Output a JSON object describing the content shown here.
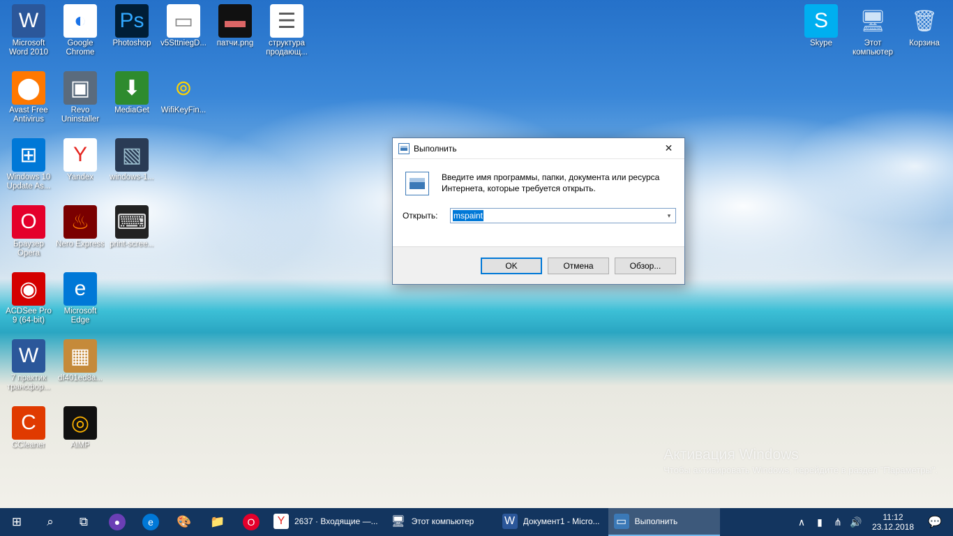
{
  "desktop": {
    "left_columns": [
      [
        {
          "name": "word",
          "label": "Microsoft Word 2010",
          "glyph": "W",
          "bg": "#2b579a",
          "fg": "#fff"
        },
        {
          "name": "avast",
          "label": "Avast Free Antivirus",
          "glyph": "⬤",
          "bg": "#ff7800",
          "fg": "#fff"
        },
        {
          "name": "win10update",
          "label": "Windows 10 Update As...",
          "glyph": "⊞",
          "bg": "#0078d7",
          "fg": "#fff"
        },
        {
          "name": "opera",
          "label": "Браузер Opera",
          "glyph": "O",
          "bg": "#e4002b",
          "fg": "#fff"
        },
        {
          "name": "acdsee",
          "label": "ACDSee Pro 9 (64-bit)",
          "glyph": "◉",
          "bg": "#d40000",
          "fg": "#fff"
        },
        {
          "name": "doc7praktik",
          "label": "7 практик трансфор...",
          "glyph": "W",
          "bg": "#2b579a",
          "fg": "#fff"
        },
        {
          "name": "ccleaner",
          "label": "CCleaner",
          "glyph": "C",
          "bg": "#e03a00",
          "fg": "#fff"
        }
      ],
      [
        {
          "name": "chrome",
          "label": "Google Chrome",
          "glyph": "◐",
          "bg": "#fff",
          "fg": "#1a73e8"
        },
        {
          "name": "revo",
          "label": "Revo Uninstaller",
          "glyph": "▣",
          "bg": "#5a6b7d",
          "fg": "#fff"
        },
        {
          "name": "yandex",
          "label": "Yandex",
          "glyph": "Y",
          "bg": "#fff",
          "fg": "#e52620"
        },
        {
          "name": "nero",
          "label": "Nero Express",
          "glyph": "♨",
          "bg": "#7a0000",
          "fg": "#ff7a00"
        },
        {
          "name": "edge",
          "label": "Microsoft Edge",
          "glyph": "e",
          "bg": "#0078d7",
          "fg": "#fff"
        },
        {
          "name": "df401",
          "label": "df401ed8a...",
          "glyph": "▦",
          "bg": "#c58a3a",
          "fg": "#fff"
        },
        {
          "name": "aimp",
          "label": "AIMP",
          "glyph": "◎",
          "bg": "#111",
          "fg": "#ffb400"
        }
      ],
      [
        {
          "name": "photoshop",
          "label": "Photoshop",
          "glyph": "Ps",
          "bg": "#001e36",
          "fg": "#31a8ff"
        },
        {
          "name": "mediaget",
          "label": "MediaGet",
          "glyph": "⬇",
          "bg": "#2e8b2e",
          "fg": "#fff"
        },
        {
          "name": "windows1img",
          "label": "windows-1...",
          "glyph": "▧",
          "bg": "#2a3b55",
          "fg": "#9bc"
        },
        {
          "name": "printscreen",
          "label": "print-scree...",
          "glyph": "⌨",
          "bg": "#222",
          "fg": "#ddd"
        }
      ],
      [
        {
          "name": "v5stt",
          "label": "v5SttniegD...",
          "glyph": "▭",
          "bg": "#fff",
          "fg": "#888"
        },
        {
          "name": "wifikey",
          "label": "WifiKeyFin...",
          "glyph": "⊚",
          "bg": "transparent",
          "fg": "#ffd400"
        }
      ],
      [
        {
          "name": "patchi",
          "label": "патчи.png",
          "glyph": "▬",
          "bg": "#111",
          "fg": "#d66"
        }
      ],
      [
        {
          "name": "struktura",
          "label": "структура продающ...",
          "glyph": "☰",
          "bg": "#fff",
          "fg": "#555"
        }
      ]
    ],
    "right_icons": [
      {
        "name": "skype",
        "label": "Skype",
        "glyph": "S",
        "bg": "#00aff0",
        "fg": "#fff"
      },
      {
        "name": "thispc",
        "label": "Этот компьютер",
        "glyph": "🖥",
        "bg": "transparent",
        "fg": "#cfe3f7"
      },
      {
        "name": "recycle",
        "label": "Корзина",
        "glyph": "🗑",
        "bg": "transparent",
        "fg": "#cfe3f7"
      }
    ]
  },
  "run_dialog": {
    "title": "Выполнить",
    "message": "Введите имя программы, папки, документа или ресурса Интернета, которые требуется открыть.",
    "open_label": "Открыть:",
    "input_value": "mspaint",
    "buttons": {
      "ok": "OK",
      "cancel": "Отмена",
      "browse": "Обзор..."
    }
  },
  "activation": {
    "title": "Активация Windows",
    "message": "Чтобы активировать Windows, перейдите в раздел \"Параметры\"."
  },
  "taskbar": {
    "pinned": [
      {
        "name": "start",
        "glyph": "⊞"
      },
      {
        "name": "search",
        "glyph": "⌕"
      },
      {
        "name": "taskview",
        "glyph": "⧉"
      },
      {
        "name": "cortana",
        "glyph": "●",
        "bg": "#6b3fb5"
      },
      {
        "name": "edge",
        "glyph": "e",
        "bg": "#0078d7"
      },
      {
        "name": "paint",
        "glyph": "🎨"
      },
      {
        "name": "explorer",
        "glyph": "📁"
      },
      {
        "name": "opera",
        "glyph": "O",
        "bg": "#e4002b"
      }
    ],
    "running": [
      {
        "name": "yandex-mail",
        "label": "2637 · Входящие —...",
        "glyph": "Y",
        "bg": "#fff",
        "fg": "#e52620",
        "active": false
      },
      {
        "name": "thispc-window",
        "label": "Этот компьютер",
        "glyph": "🖥",
        "bg": "",
        "active": false
      },
      {
        "name": "word-doc",
        "label": "Документ1 - Micro...",
        "glyph": "W",
        "bg": "#2b579a",
        "fg": "#fff",
        "active": false
      },
      {
        "name": "run-window",
        "label": "Выполнить",
        "glyph": "▭",
        "bg": "#3b79b7",
        "fg": "#fff",
        "active": true
      }
    ],
    "tray": {
      "chevron": "∧",
      "battery": "▮",
      "wifi": "⋔",
      "volume": "🔊",
      "lang": ""
    },
    "clock": {
      "time": "11:12",
      "date": "23.12.2018"
    },
    "action_center_glyph": "💬"
  }
}
